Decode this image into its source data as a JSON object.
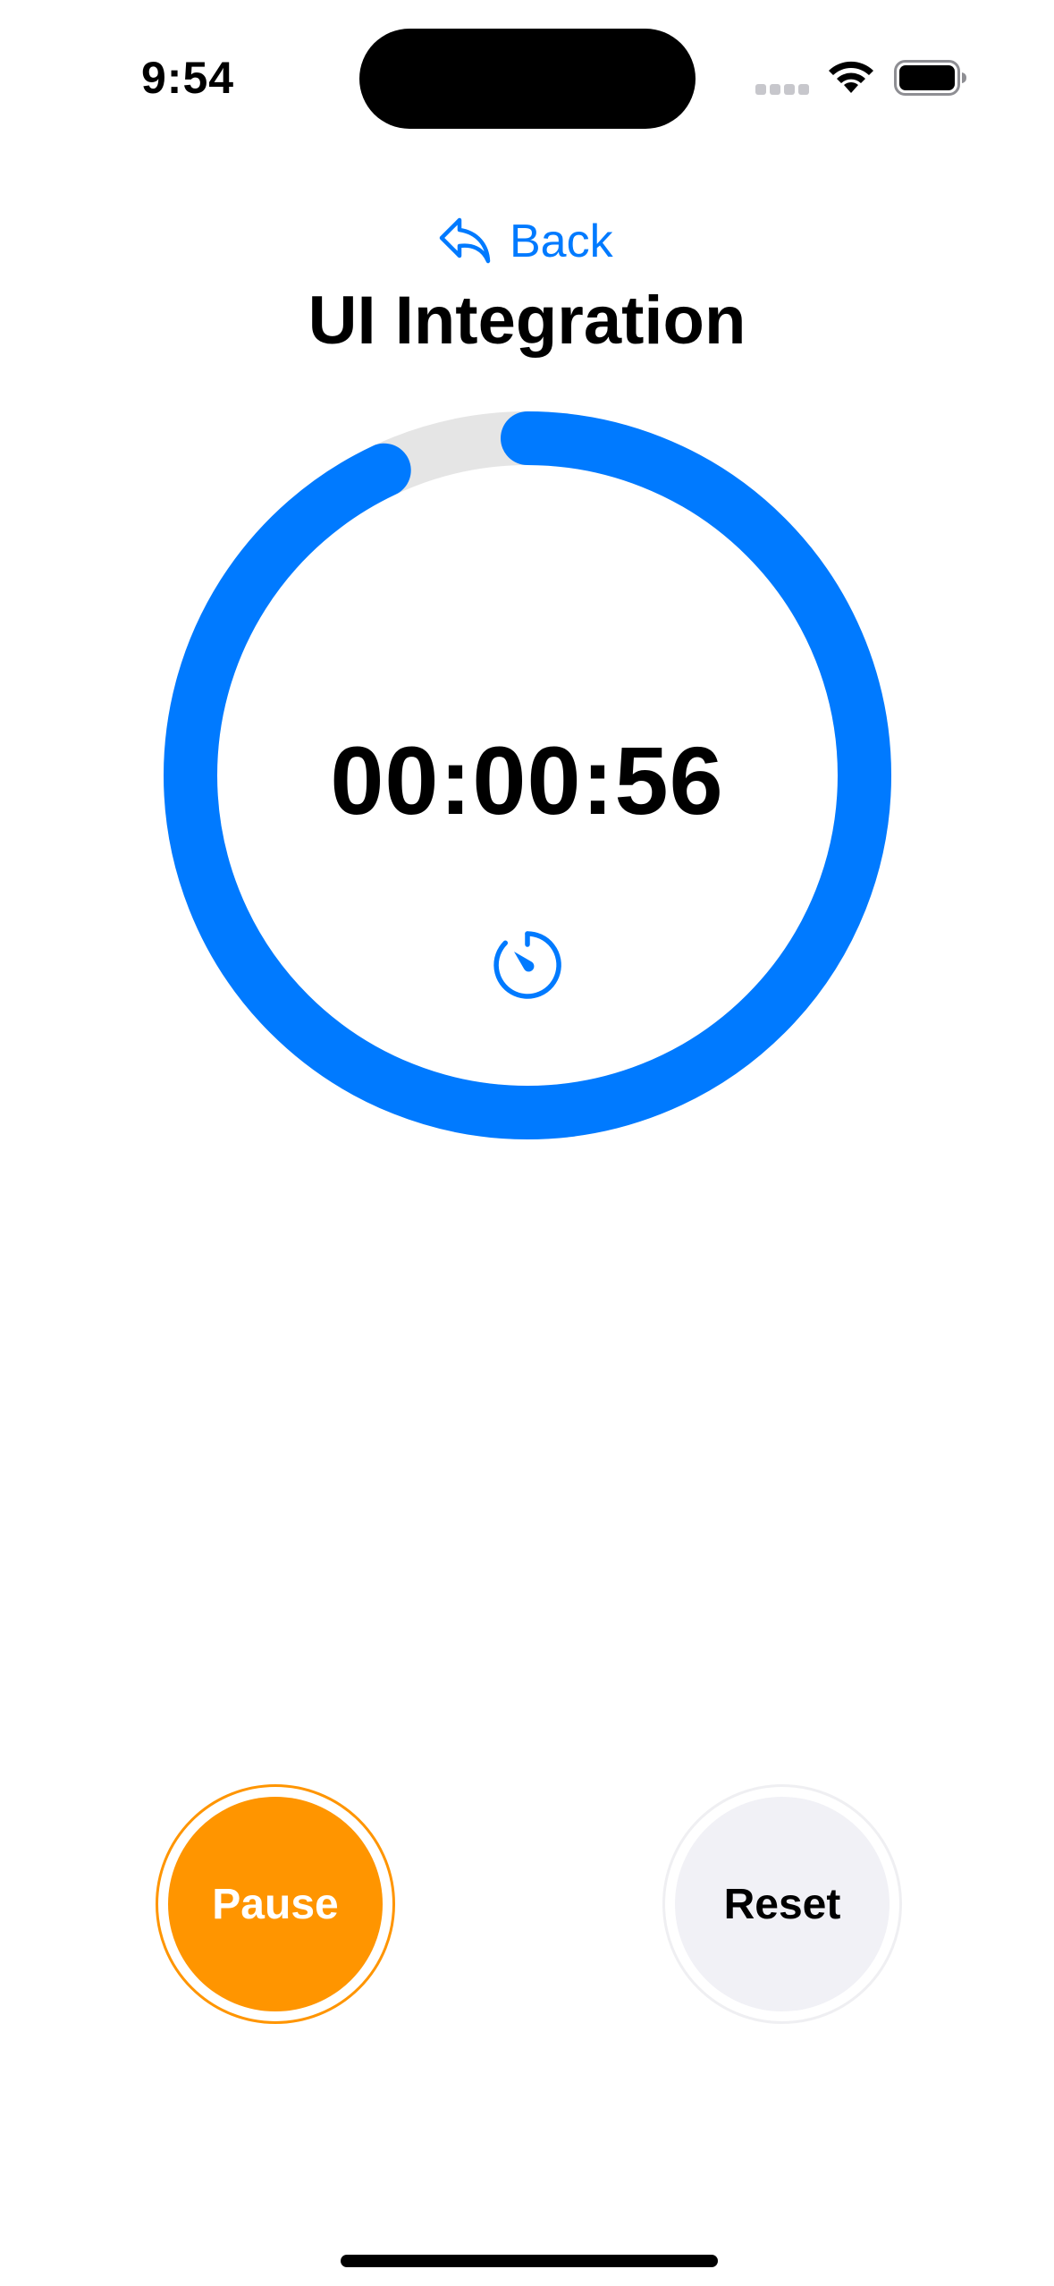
{
  "status_bar": {
    "time": "9:54"
  },
  "header": {
    "back_label": "Back",
    "title": "UI Integration"
  },
  "timer": {
    "elapsed": "00:00:56",
    "progress": 0.93
  },
  "controls": {
    "pause_label": "Pause",
    "reset_label": "Reset"
  },
  "colors": {
    "accent": "#007aff",
    "pause": "#ff9500",
    "ring_track": "#e5e5e5",
    "reset_bg": "#f1f1f6"
  },
  "icons": {
    "back": "arrowshape-turn-up-left-icon",
    "timer": "timer-icon",
    "wifi": "wifi-icon",
    "battery": "battery-icon"
  }
}
